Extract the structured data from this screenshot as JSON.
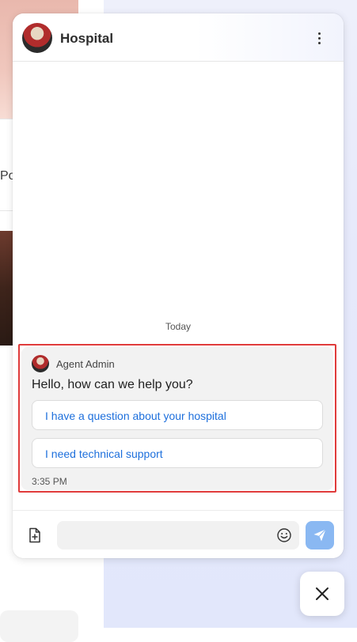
{
  "background": {
    "text_fragment": "Po"
  },
  "header": {
    "title": "Hospital",
    "menu_icon": "kebab-menu-icon"
  },
  "conversation": {
    "day_label": "Today",
    "message": {
      "sender": "Agent Admin",
      "text": "Hello, how can we help you?",
      "options": [
        "I have a question about your hospital",
        "I need technical support"
      ],
      "time": "3:35 PM"
    }
  },
  "composer": {
    "placeholder": "",
    "attach_icon": "file-plus-icon",
    "emoji_icon": "smile-icon",
    "send_icon": "send-icon"
  },
  "colors": {
    "accent": "#1d6fdc",
    "send_button": "#8ab8f2",
    "highlight_outline": "#e03b3b"
  },
  "launcher": {
    "icon": "close-icon"
  }
}
